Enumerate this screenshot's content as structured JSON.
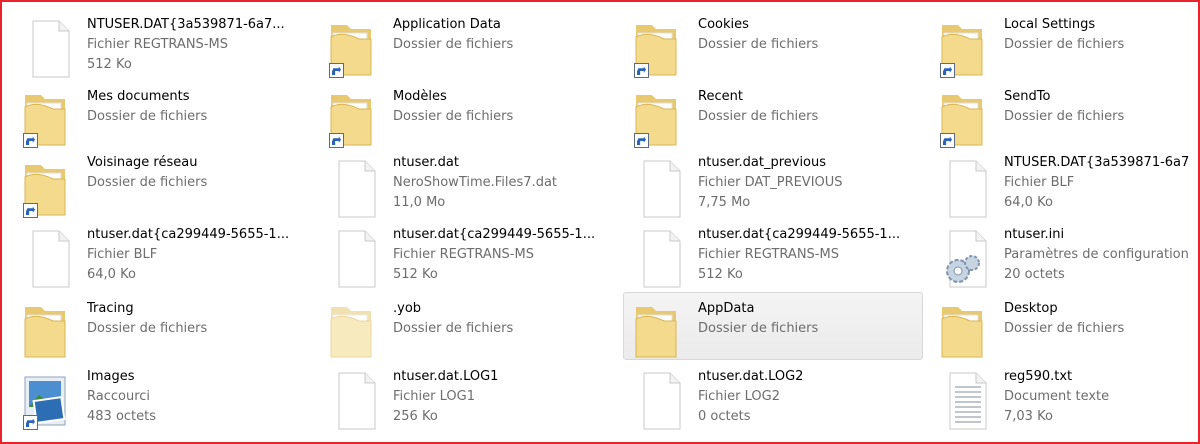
{
  "items": [
    {
      "name": "NTUSER.DAT{3a539871-6a7...",
      "type": "Fichier REGTRANS-MS",
      "size": "512 Ko",
      "icon": "blank-file-icon"
    },
    {
      "name": "Application Data",
      "type": "Dossier de fichiers",
      "size": "",
      "icon": "folder-icon",
      "shortcut": true
    },
    {
      "name": "Cookies",
      "type": "Dossier de fichiers",
      "size": "",
      "icon": "folder-icon",
      "shortcut": true
    },
    {
      "name": "Local Settings",
      "type": "Dossier de fichiers",
      "size": "",
      "icon": "folder-icon",
      "shortcut": true
    },
    {
      "name": "Mes documents",
      "type": "Dossier de fichiers",
      "size": "",
      "icon": "folder-icon",
      "shortcut": true
    },
    {
      "name": "Modèles",
      "type": "Dossier de fichiers",
      "size": "",
      "icon": "folder-icon",
      "shortcut": true
    },
    {
      "name": "Recent",
      "type": "Dossier de fichiers",
      "size": "",
      "icon": "folder-icon",
      "shortcut": true
    },
    {
      "name": "SendTo",
      "type": "Dossier de fichiers",
      "size": "",
      "icon": "folder-icon",
      "shortcut": true
    },
    {
      "name": "Voisinage réseau",
      "type": "Dossier de fichiers",
      "size": "",
      "icon": "folder-icon",
      "shortcut": true
    },
    {
      "name": "ntuser.dat",
      "type": "NeroShowTime.Files7.dat",
      "size": "11,0 Mo",
      "icon": "blank-file-icon"
    },
    {
      "name": "ntuser.dat_previous",
      "type": "Fichier DAT_PREVIOUS",
      "size": "7,75 Mo",
      "icon": "blank-file-icon"
    },
    {
      "name": "NTUSER.DAT{3a539871-6a7",
      "type": "Fichier BLF",
      "size": "64,0 Ko",
      "icon": "blank-file-icon"
    },
    {
      "name": "ntuser.dat{ca299449-5655-1...",
      "type": "Fichier BLF",
      "size": "64,0 Ko",
      "icon": "blank-file-icon"
    },
    {
      "name": "ntuser.dat{ca299449-5655-1...",
      "type": "Fichier REGTRANS-MS",
      "size": "512 Ko",
      "icon": "blank-file-icon"
    },
    {
      "name": "ntuser.dat{ca299449-5655-1...",
      "type": "Fichier REGTRANS-MS",
      "size": "512 Ko",
      "icon": "blank-file-icon"
    },
    {
      "name": "ntuser.ini",
      "type": "Paramètres de configuration",
      "size": "20 octets",
      "icon": "settings-file-icon"
    },
    {
      "name": "Tracing",
      "type": "Dossier de fichiers",
      "size": "",
      "icon": "folder-icon"
    },
    {
      "name": ".yob",
      "type": "Dossier de fichiers",
      "size": "",
      "icon": "folder-icon",
      "faded": true
    },
    {
      "name": "AppData",
      "type": "Dossier de fichiers",
      "size": "",
      "icon": "folder-icon",
      "selected": true
    },
    {
      "name": "Desktop",
      "type": "Dossier de fichiers",
      "size": "",
      "icon": "folder-icon"
    },
    {
      "name": "Images",
      "type": "Raccourci",
      "size": "483 octets",
      "icon": "pictures-shortcut-icon",
      "shortcut": true
    },
    {
      "name": "ntuser.dat.LOG1",
      "type": "Fichier LOG1",
      "size": "256 Ko",
      "icon": "blank-file-icon"
    },
    {
      "name": "ntuser.dat.LOG2",
      "type": "Fichier LOG2",
      "size": "0 octets",
      "icon": "blank-file-icon"
    },
    {
      "name": "reg590.txt",
      "type": "Document texte",
      "size": "7,03 Ko",
      "icon": "text-file-icon"
    }
  ]
}
